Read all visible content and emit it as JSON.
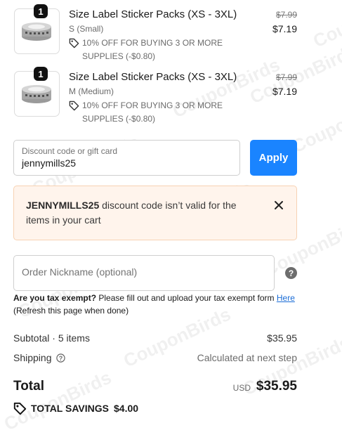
{
  "line_items": [
    {
      "quantity": "1",
      "title": "Size Label Sticker Packs (XS - 3XL)",
      "variant": "S (Small)",
      "discount_text": "10% OFF FOR BUYING 3 OR MORE SUPPLIES (-$0.80)",
      "original_price": "$7.99",
      "price": "$7.19"
    },
    {
      "quantity": "1",
      "title": "Size Label Sticker Packs (XS - 3XL)",
      "variant": "M (Medium)",
      "discount_text": "10% OFF FOR BUYING 3 OR MORE SUPPLIES (-$0.80)",
      "original_price": "$7.99",
      "price": "$7.19"
    }
  ],
  "discount": {
    "label": "Discount code or gift card",
    "value": "jennymills25",
    "apply_label": "Apply"
  },
  "error": {
    "code": "JENNYMILLS25",
    "message": " discount code isn’t valid for the items in your cart"
  },
  "nickname": {
    "placeholder": "Order Nickname (optional)"
  },
  "tax": {
    "bold": "Are you tax exempt?",
    "text": " Please fill out and upload your tax exempt form ",
    "link": "Here",
    "note": "(Refresh this page when done)"
  },
  "summary": {
    "subtotal_label": "Subtotal · 5 items",
    "subtotal_value": "$35.95",
    "shipping_label": "Shipping",
    "shipping_value": "Calculated at next step",
    "total_label": "Total",
    "currency": "USD",
    "total_value": "$35.95",
    "savings_label": "TOTAL SAVINGS",
    "savings_value": "$4.00"
  },
  "colors": {
    "accent": "#1a84ff",
    "error_bg": "#fff4ec",
    "link": "#1a6cd6"
  },
  "icons": [
    "tag-icon",
    "close-icon",
    "help-icon",
    "info-icon"
  ]
}
